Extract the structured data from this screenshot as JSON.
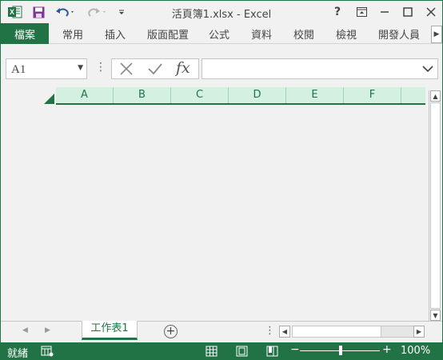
{
  "window": {
    "title": "活頁簿1.xlsx - Excel",
    "help": "?",
    "accent": "#217346"
  },
  "ribbon": {
    "file_tab": "檔案",
    "tabs": [
      "常用",
      "插入",
      "版面配置",
      "公式",
      "資料",
      "校閱",
      "檢視",
      "開發人員"
    ]
  },
  "formula_bar": {
    "name_box": "A1",
    "function_label": "fx",
    "formula": ""
  },
  "sheet": {
    "columns": [
      "A",
      "B",
      "C",
      "D",
      "E",
      "F"
    ]
  },
  "sheet_tabs": {
    "active": "工作表1"
  },
  "status_bar": {
    "status": "就緒",
    "zoom": "100%"
  },
  "icons": {
    "app": "excel-logo-icon",
    "save": "save-icon",
    "undo": "undo-icon",
    "redo": "redo-icon",
    "customize": "customize-qat-icon"
  }
}
